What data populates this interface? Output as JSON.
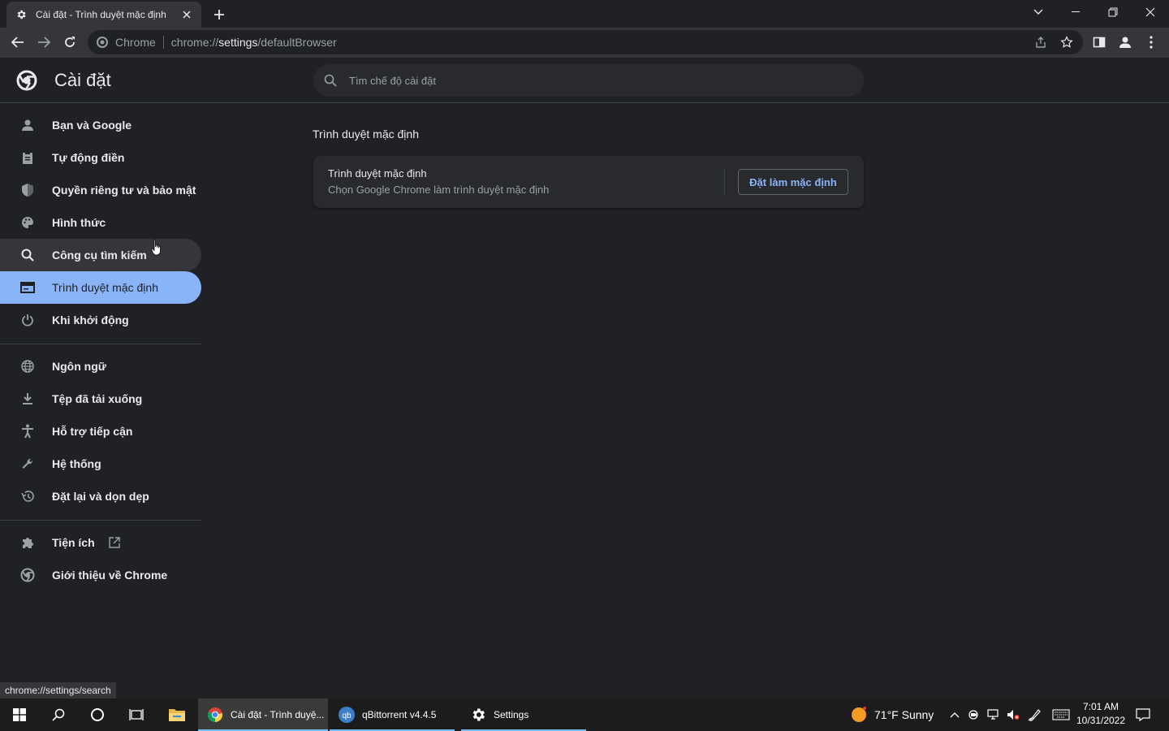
{
  "browser": {
    "tab_title": "Cài đặt - Trình duyệt mặc định",
    "site_label": "Chrome",
    "url_prefix": "chrome://",
    "url_host": "settings",
    "url_path": "/defaultBrowser"
  },
  "header": {
    "title": "Cài đặt",
    "search_placeholder": "Tìm chế độ cài đặt"
  },
  "sidebar": {
    "items": [
      {
        "label": "Bạn và Google",
        "icon": "person-icon"
      },
      {
        "label": "Tự động điền",
        "icon": "clipboard-icon"
      },
      {
        "label": "Quyền riêng tư và bảo mật",
        "icon": "shield-icon"
      },
      {
        "label": "Hình thức",
        "icon": "palette-icon"
      },
      {
        "label": "Công cụ tìm kiếm",
        "icon": "search-icon"
      },
      {
        "label": "Trình duyệt mặc định",
        "icon": "browser-icon"
      },
      {
        "label": "Khi khởi động",
        "icon": "power-icon"
      },
      {
        "label": "Ngôn ngữ",
        "icon": "globe-icon"
      },
      {
        "label": "Tệp đã tải xuống",
        "icon": "download-icon"
      },
      {
        "label": "Hỗ trợ tiếp cận",
        "icon": "accessibility-icon"
      },
      {
        "label": "Hệ thống",
        "icon": "wrench-icon"
      },
      {
        "label": "Đặt lại và dọn dẹp",
        "icon": "history-icon"
      },
      {
        "label": "Tiện ích",
        "icon": "puzzle-icon"
      },
      {
        "label": "Giới thiệu về Chrome",
        "icon": "chrome-icon"
      }
    ]
  },
  "main": {
    "section_title": "Trình duyệt mặc định",
    "card": {
      "title": "Trình duyệt mặc định",
      "subtitle": "Chọn Google Chrome làm trình duyệt mặc định",
      "button": "Đặt làm mặc định"
    }
  },
  "status_bar": "chrome://settings/search",
  "taskbar": {
    "apps": [
      {
        "label": "Cài đặt - Trình duyệ..."
      },
      {
        "label": "qBittorrent v4.4.5"
      },
      {
        "label": "Settings"
      }
    ],
    "weather": "71°F  Sunny",
    "time": "7:01 AM",
    "date": "10/31/2022"
  },
  "colors": {
    "accent": "#8ab4f8",
    "background": "#202124",
    "surface": "#292a2d"
  }
}
